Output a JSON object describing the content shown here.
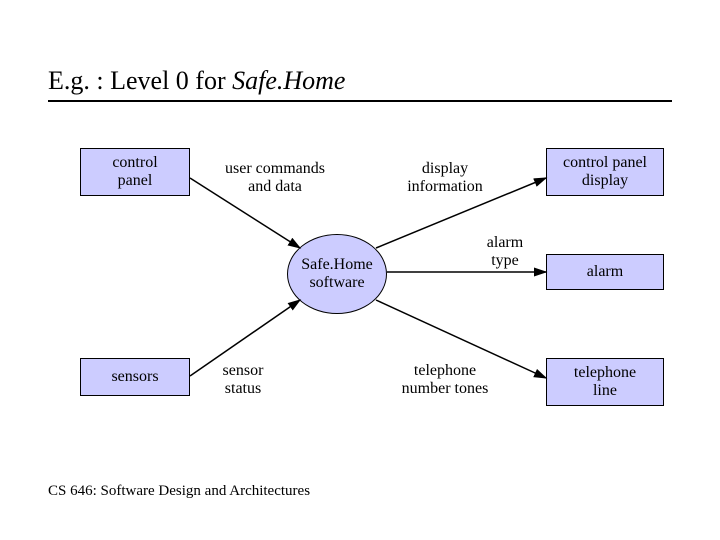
{
  "title_prefix": "E.g. : Level 0 for ",
  "title_emph": "Safe.Home",
  "entities": {
    "control_panel": "control\npanel",
    "control_display": "control panel\ndisplay",
    "alarm": "alarm",
    "sensors": "sensors",
    "telephone_line": "telephone\nline"
  },
  "process": "Safe.Home\nsoftware",
  "flows": {
    "user_cmds": "user commands\nand data",
    "display_info": "display\ninformation",
    "alarm_type": "alarm\ntype",
    "sensor_status": "sensor\nstatus",
    "tel_tones": "telephone\nnumber tones"
  },
  "footer": "CS 646: Software Design and Architectures"
}
